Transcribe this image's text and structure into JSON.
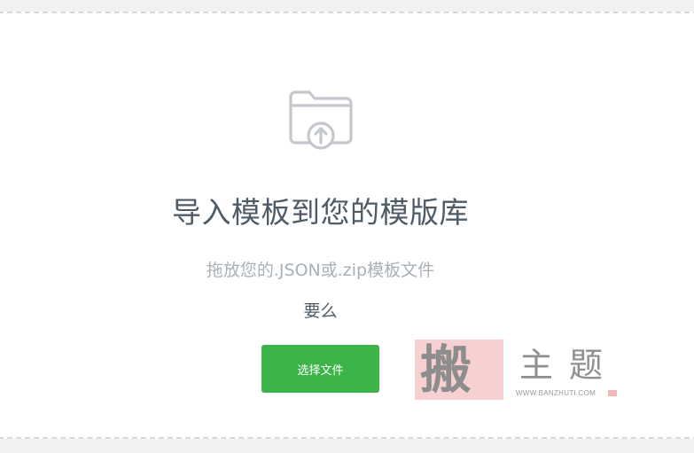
{
  "dropzone": {
    "icon": "folder-upload-icon",
    "title": "导入模板到您的模版库",
    "hint": "拖放您的.JSON或.zip模板文件",
    "or_text": "要么",
    "select_button_label": "选择文件"
  },
  "watermark": {
    "seal_char": "搬",
    "chars": "主题",
    "url": "WWW.BANZHUTI.COM"
  },
  "colors": {
    "button_green": "#3bb54a",
    "title_text": "#4f5b66",
    "hint_text": "#a8b0b8",
    "icon_gray": "#c4c8cc",
    "dashed_border": "#d6d8dc"
  }
}
